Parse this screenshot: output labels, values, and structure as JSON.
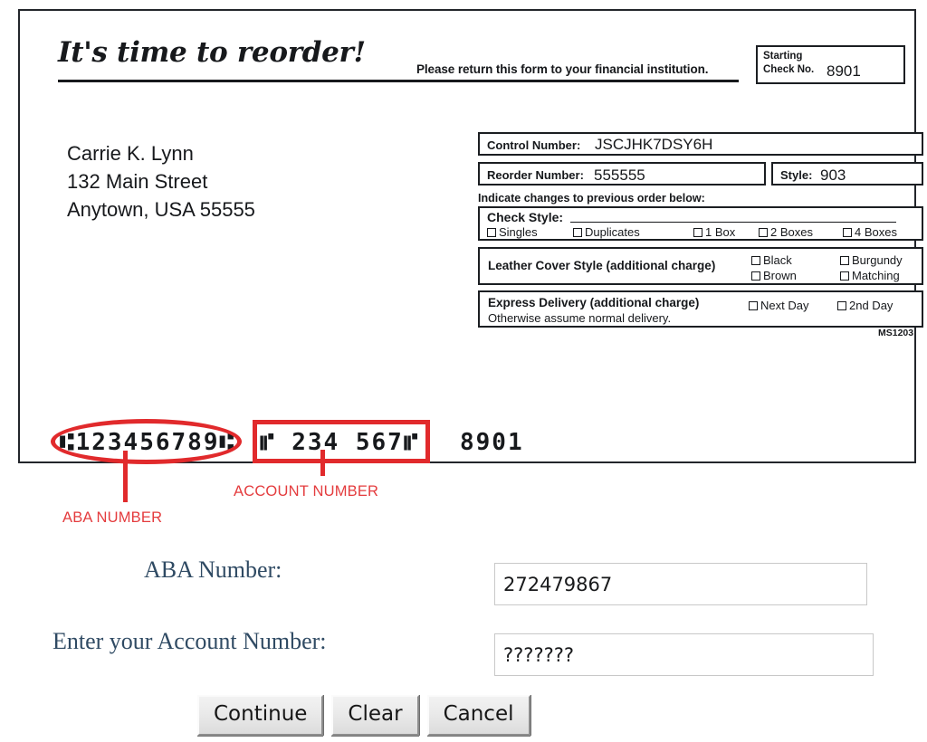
{
  "check": {
    "reorder_title": "It's time to reorder!",
    "return_note": "Please return this form to your financial institution.",
    "starting_check": {
      "label_line1": "Starting",
      "label_line2": "Check No.",
      "value": "8901"
    },
    "address": {
      "line1": "Carrie K. Lynn",
      "line2": "132 Main Street",
      "line3": "Anytown, USA 55555"
    },
    "control_number": {
      "label": "Control Number:",
      "value": "JSCJHK7DSY6H"
    },
    "reorder_number": {
      "label": "Reorder Number:",
      "value": "555555"
    },
    "style": {
      "label": "Style:",
      "value": "903"
    },
    "indicate_note": "Indicate changes to previous order below:",
    "check_style": {
      "title": "Check Style:",
      "options": [
        "Singles",
        "Duplicates",
        "1 Box",
        "2 Boxes",
        "4 Boxes"
      ]
    },
    "leather_cover": {
      "title": "Leather Cover Style (additional charge)",
      "options": [
        "Black",
        "Burgundy",
        "Brown",
        "Matching"
      ]
    },
    "express_delivery": {
      "title": "Express Delivery (additional charge)",
      "subtitle": "Otherwise assume normal delivery.",
      "options": [
        "Next Day",
        "2nd Day"
      ]
    },
    "form_code": "MS1203",
    "micr": {
      "aba": "⑆123456789⑆",
      "account": "⑈ 234 567⑈",
      "check_number": "8901"
    },
    "annotations": {
      "aba_label": "ABA NUMBER",
      "account_label": "ACCOUNT NUMBER",
      "color": "#e12a2c"
    }
  },
  "form": {
    "aba_label": "ABA Number:",
    "aba_value": "272479867",
    "aba_placeholder": "",
    "account_label": "Enter your Account Number:",
    "account_value": "???????",
    "account_placeholder": "",
    "label_color": "#2f4a63"
  },
  "buttons": {
    "continue": "Continue",
    "clear": "Clear",
    "cancel": "Cancel"
  }
}
